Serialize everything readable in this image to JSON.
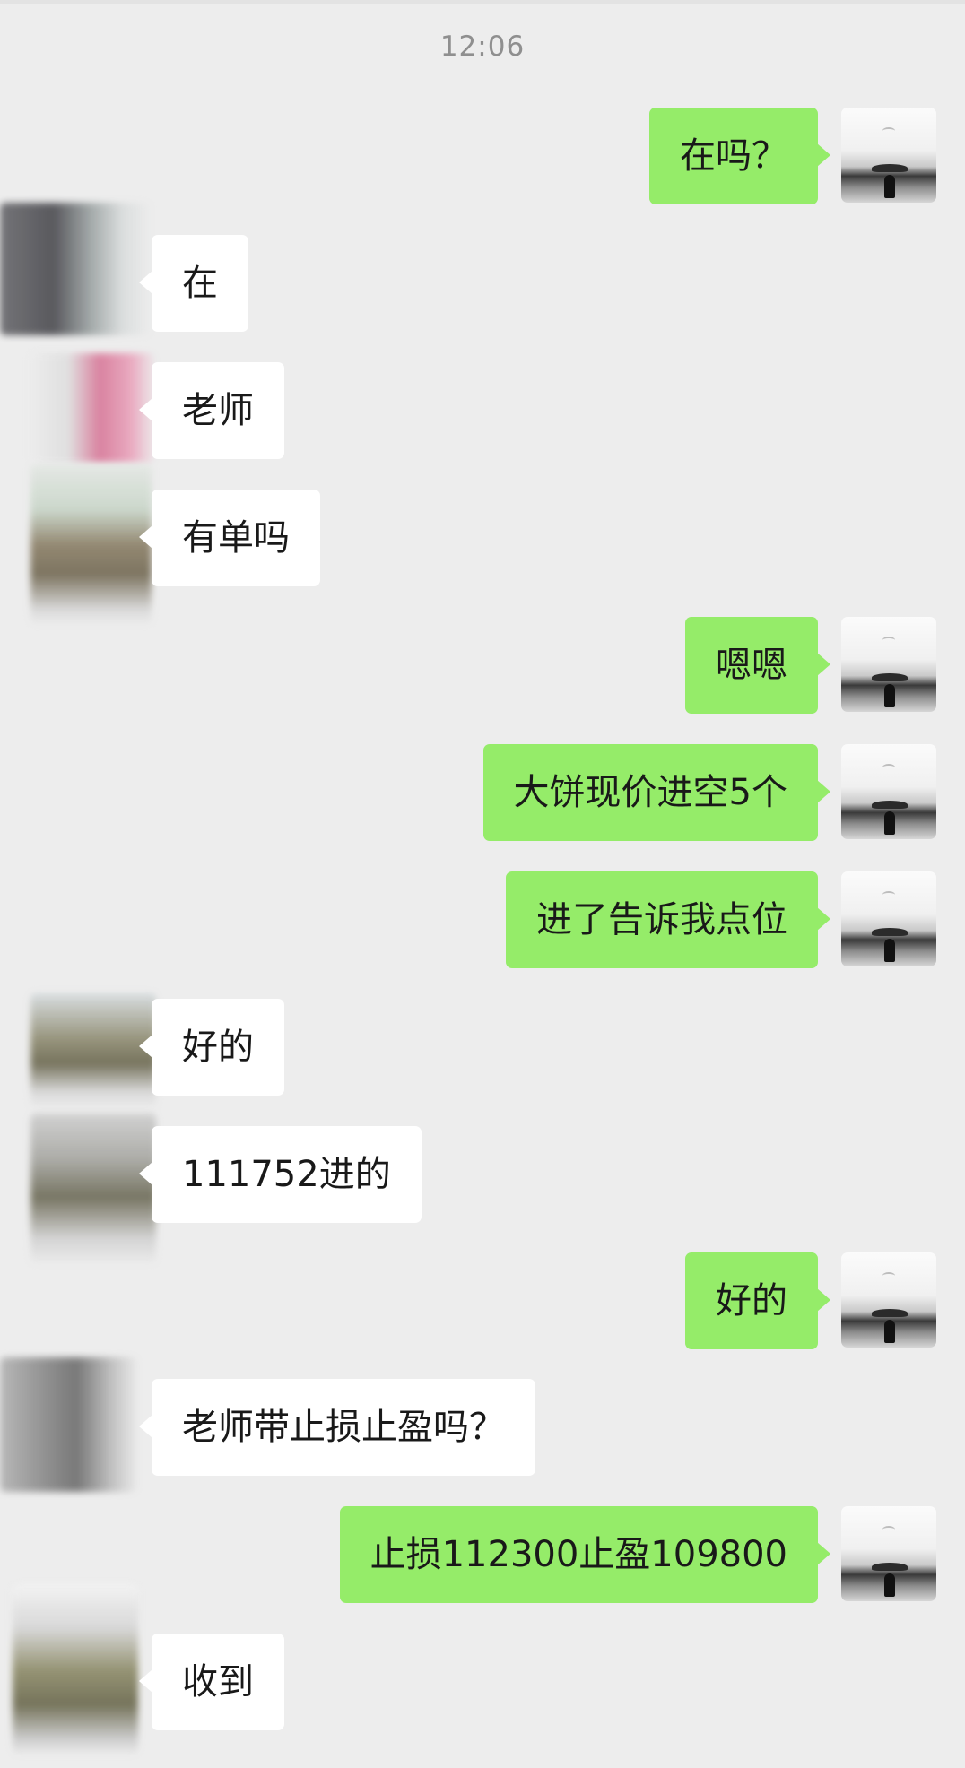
{
  "timestamp": "12:06",
  "colors": {
    "background": "#ededed",
    "outgoing_bubble": "#95ec69",
    "incoming_bubble": "#ffffff",
    "text": "#191919",
    "timestamp": "#8f8f8f"
  },
  "messages": [
    {
      "sender": "self",
      "text": "在吗？"
    },
    {
      "sender": "contact",
      "text": "在"
    },
    {
      "sender": "contact",
      "text": "老师"
    },
    {
      "sender": "contact",
      "text": "有单吗"
    },
    {
      "sender": "self",
      "text": "嗯嗯"
    },
    {
      "sender": "self",
      "text": "大饼现价进空5个"
    },
    {
      "sender": "self",
      "text": "进了告诉我点位"
    },
    {
      "sender": "contact",
      "text": "好的"
    },
    {
      "sender": "contact",
      "text": "111752进的"
    },
    {
      "sender": "self",
      "text": "好的"
    },
    {
      "sender": "contact",
      "text": "老师带止损止盈吗？"
    },
    {
      "sender": "self",
      "text": "止损112300止盈109800"
    },
    {
      "sender": "contact",
      "text": "收到"
    }
  ]
}
